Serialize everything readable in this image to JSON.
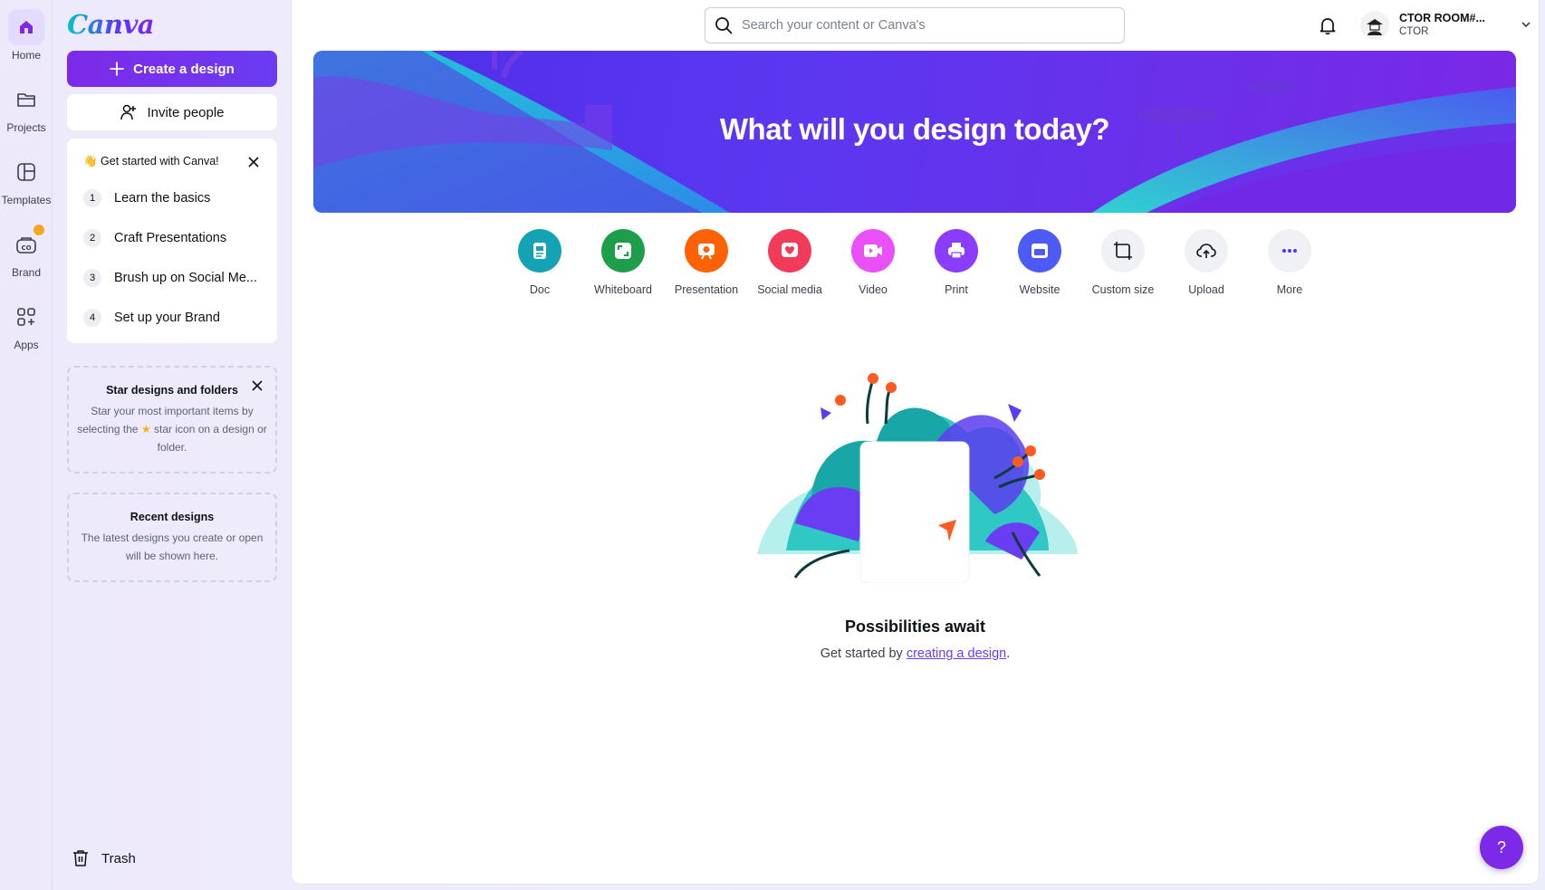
{
  "rail": {
    "items": [
      {
        "label": "Home",
        "icon": "home-icon"
      },
      {
        "label": "Projects",
        "icon": "folder-icon"
      },
      {
        "label": "Templates",
        "icon": "templates-icon"
      },
      {
        "label": "Brand",
        "icon": "brand-icon"
      },
      {
        "label": "Apps",
        "icon": "apps-icon"
      }
    ],
    "active": "Home"
  },
  "panel": {
    "logo": "Canva",
    "create_label": "Create a design",
    "invite_label": "Invite people",
    "get_started": {
      "title": "👋 Get started with Canva!",
      "steps": [
        {
          "num": "1",
          "label": "Learn the basics"
        },
        {
          "num": "2",
          "label": "Craft Presentations"
        },
        {
          "num": "3",
          "label": "Brush up on Social Me..."
        },
        {
          "num": "4",
          "label": "Set up your Brand"
        }
      ]
    },
    "star_card": {
      "title": "Star designs and folders",
      "desc_before": "Star your most important items by selecting the",
      "desc_after": "star icon on a design or folder."
    },
    "recent_card": {
      "title": "Recent designs",
      "desc": "The latest designs you create or open will be shown here."
    },
    "trash_label": "Trash"
  },
  "header": {
    "search_placeholder": "Search your content or Canva's",
    "account_name": "CTOR ROOM#...",
    "account_org": "CTOR"
  },
  "hero": {
    "title": "What will you design today?"
  },
  "quick_create": [
    {
      "label": "Doc",
      "icon": "doc-icon",
      "color": "#13a3b5"
    },
    {
      "label": "Whiteboard",
      "icon": "whiteboard-icon",
      "color": "#1e9e4a"
    },
    {
      "label": "Presentation",
      "icon": "presentation-icon",
      "color": "#ff6105"
    },
    {
      "label": "Social media",
      "icon": "social-media-icon",
      "color": "#f23a5b"
    },
    {
      "label": "Video",
      "icon": "video-icon",
      "color": "#e950f7"
    },
    {
      "label": "Print",
      "icon": "print-icon",
      "color": "#8b3dff"
    },
    {
      "label": "Website",
      "icon": "website-icon",
      "color": "#4c5bf5"
    },
    {
      "label": "Custom size",
      "icon": "custom-size-icon",
      "color": "#f0f1f5"
    },
    {
      "label": "Upload",
      "icon": "upload-icon",
      "color": "#f0f1f5"
    },
    {
      "label": "More",
      "icon": "more-icon",
      "color": "#f0f1f5"
    }
  ],
  "empty_state": {
    "title": "Possibilities await",
    "desc_prefix": "Get started by ",
    "link": "creating a design",
    "desc_suffix": "."
  },
  "help_label": "?",
  "colors": {
    "accent": "#7d2ae8",
    "hero_start": "#4e2ee8",
    "hero_end": "#7b28e6",
    "teal": "#2fd2d0"
  }
}
